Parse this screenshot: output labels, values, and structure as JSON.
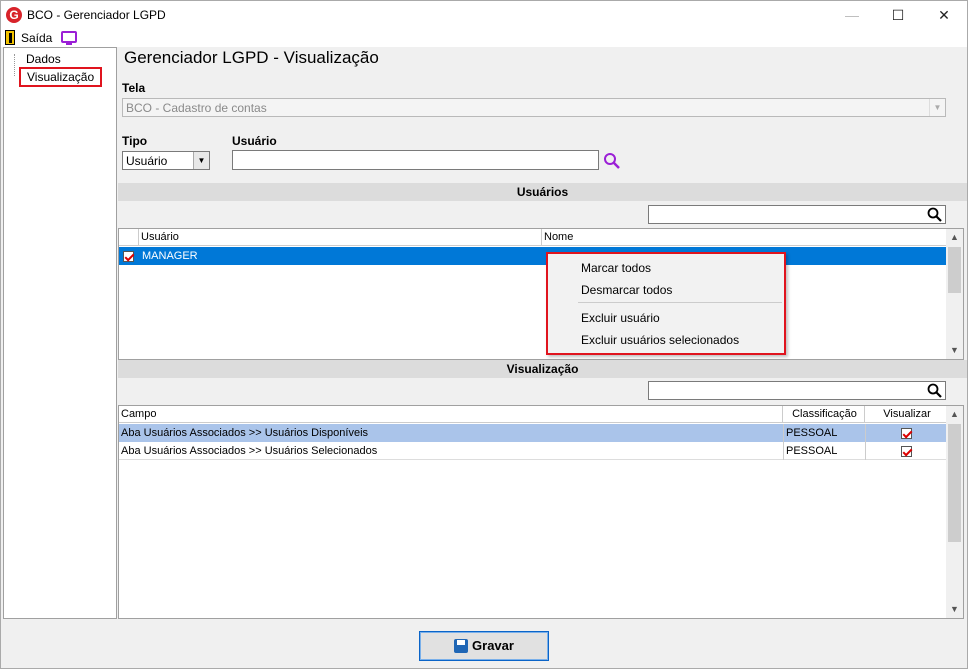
{
  "window": {
    "title": "BCO - Gerenciador LGPD",
    "app_icon_letter": "G",
    "minimize": "—",
    "maximize": "☐",
    "close": "✕"
  },
  "toolbar": {
    "exit_label": "Saída"
  },
  "tree": {
    "items": [
      "Dados",
      "Visualização"
    ],
    "selected": "Visualização"
  },
  "main": {
    "title": "Gerenciador LGPD - Visualização",
    "tela_label": "Tela",
    "tela_value": "BCO - Cadastro de contas",
    "tipo_label": "Tipo",
    "tipo_value": "Usuário",
    "usuario_label": "Usuário",
    "usuario_value": ""
  },
  "usuarios_section": {
    "title": "Usuários",
    "columns": [
      "Usuário",
      "Nome"
    ],
    "rows": [
      {
        "checked": true,
        "usuario": "MANAGER",
        "nome": ""
      }
    ]
  },
  "context_menu": {
    "items": [
      "Marcar todos",
      "Desmarcar todos",
      "Excluir usuário",
      "Excluir usuários selecionados"
    ]
  },
  "visualizacao_section": {
    "title": "Visualização",
    "columns": [
      "Campo",
      "Classificação",
      "Visualizar"
    ],
    "rows": [
      {
        "campo": "Aba Usuários Associados >> Usuários Disponíveis",
        "classificacao": "PESSOAL",
        "visualizar": true
      },
      {
        "campo": "Aba Usuários Associados >> Usuários Selecionados",
        "classificacao": "PESSOAL",
        "visualizar": true
      }
    ]
  },
  "footer": {
    "gravar_label": "Gravar"
  },
  "colors": {
    "accent_red": "#e0141e",
    "selection_blue": "#0078d7",
    "purple_icon": "#9b1fd6"
  }
}
